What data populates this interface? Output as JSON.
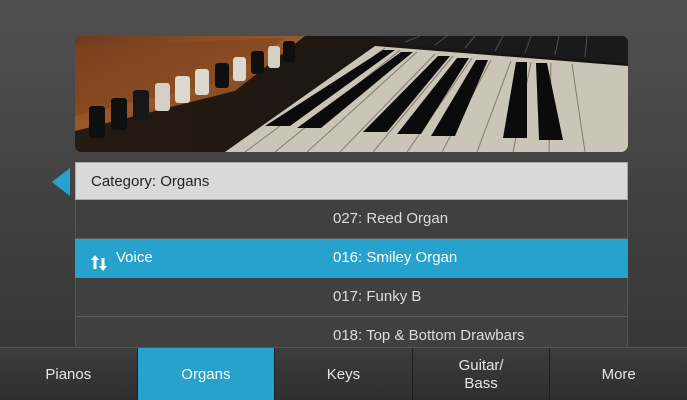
{
  "header_image": {
    "alt": "organ-keyboard-photo"
  },
  "category": {
    "label": "Category: Organs"
  },
  "list": {
    "rows": [
      {
        "label": "",
        "value": "027: Reed Organ",
        "selected": false
      },
      {
        "label": "Voice",
        "value": "016: Smiley Organ",
        "selected": true
      },
      {
        "label": "",
        "value": "017: Funky B",
        "selected": false
      },
      {
        "label": "",
        "value": "018: Top & Bottom Drawbars",
        "selected": false
      }
    ]
  },
  "tabs": [
    {
      "label": "Pianos",
      "active": false
    },
    {
      "label": "Organs",
      "active": true
    },
    {
      "label": "Keys",
      "active": false
    },
    {
      "label": "Guitar/\nBass",
      "active": false
    },
    {
      "label": "More",
      "active": false
    }
  ],
  "colors": {
    "accent": "#27a2cd",
    "header_bg": "#d9d9d9",
    "row_bg": "#404040"
  },
  "icons": {
    "back": "triangle-left-icon",
    "sort": "sort-arrows-icon"
  }
}
